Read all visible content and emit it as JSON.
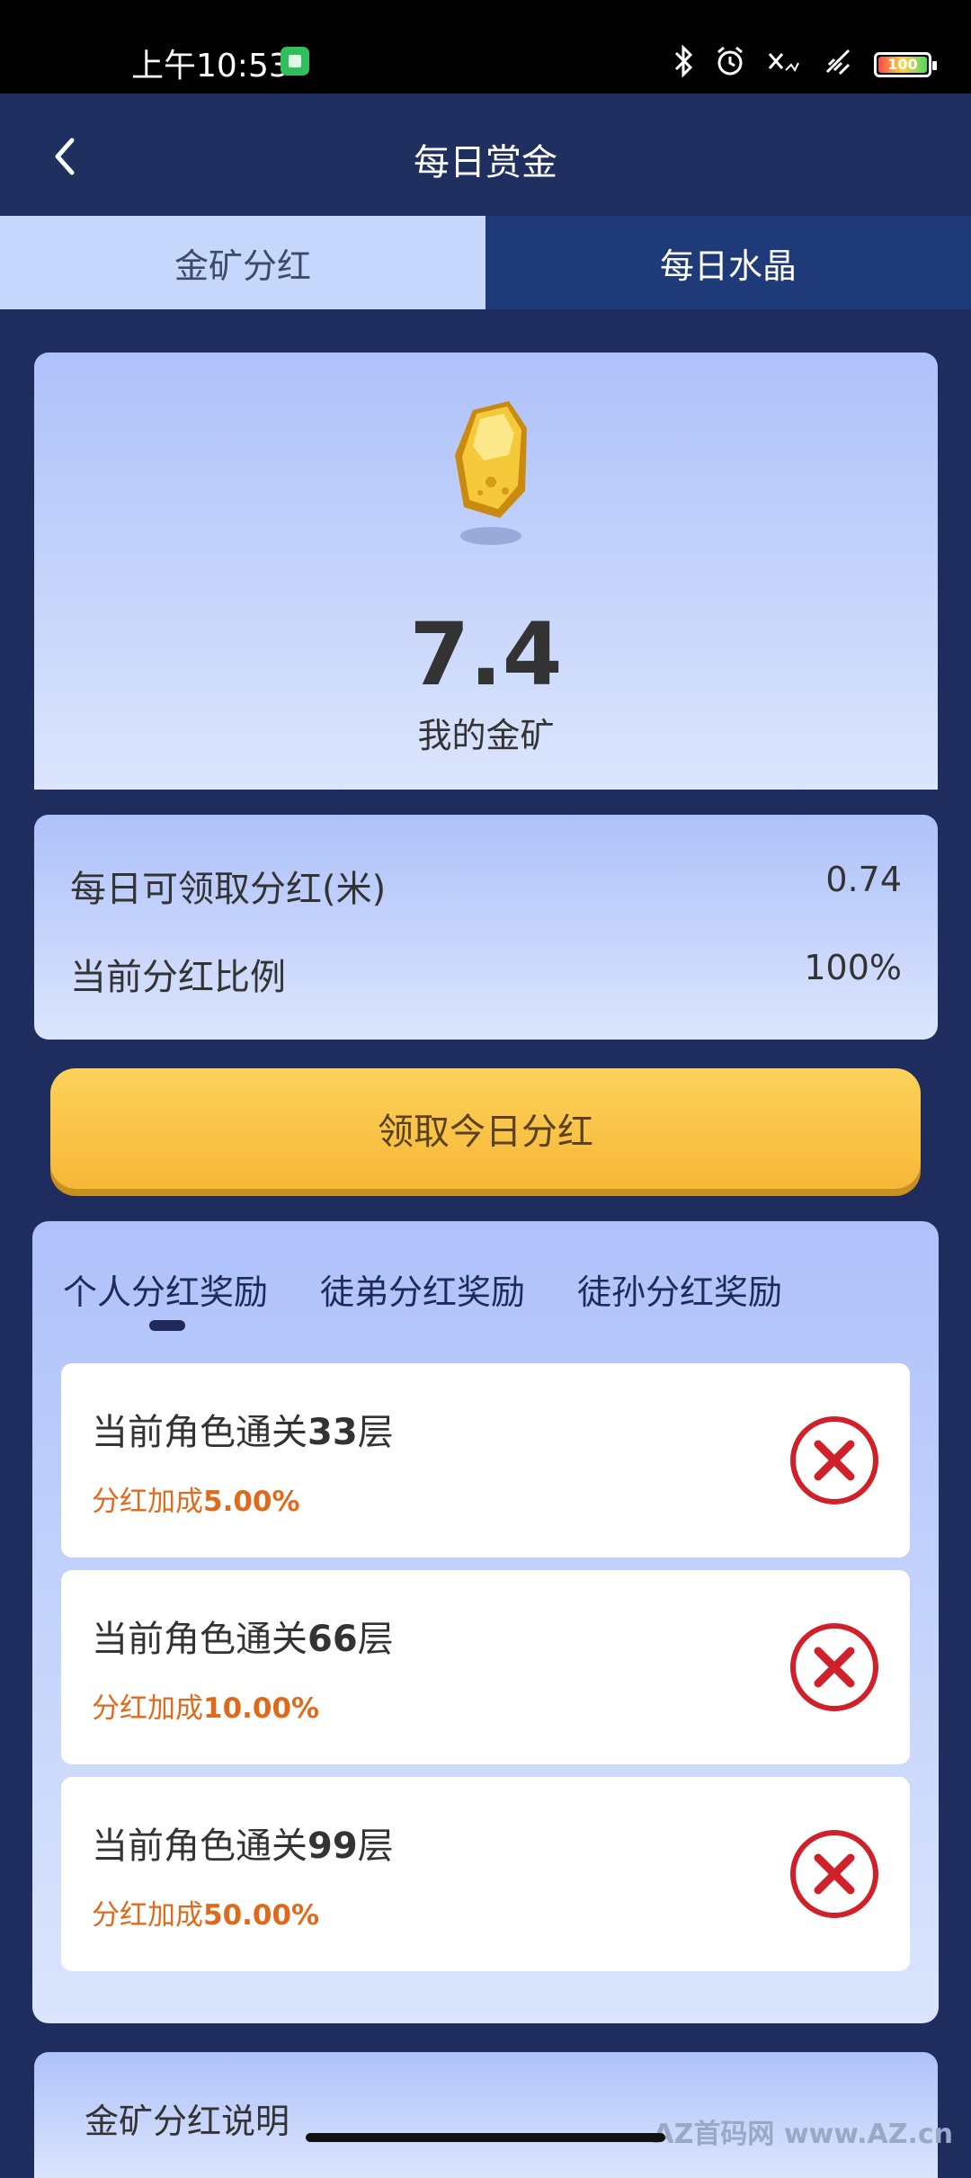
{
  "status_bar": {
    "time": "上午10:53",
    "icons": [
      "app-notification-icon",
      "bluetooth-icon",
      "alarm-icon",
      "no-signal-icon",
      "wifi-off-icon",
      "battery-icon"
    ],
    "battery_level": "100"
  },
  "header": {
    "title": "每日赏金"
  },
  "tabs": [
    {
      "label": "金矿分红",
      "active": true
    },
    {
      "label": "每日水晶",
      "active": false
    }
  ],
  "hero": {
    "value": "7.4",
    "label": "我的金矿"
  },
  "info": {
    "rows": [
      {
        "label": "每日可领取分红(米)",
        "value": "0.74"
      },
      {
        "label": "当前分红比例",
        "value": "100%"
      }
    ]
  },
  "claim_button": {
    "label": "领取今日分红"
  },
  "rewards": {
    "tabs": [
      {
        "label": "个人分红奖励",
        "active": true
      },
      {
        "label": "徒弟分红奖励",
        "active": false
      },
      {
        "label": "徒孙分红奖励",
        "active": false
      }
    ],
    "items": [
      {
        "title_prefix": "当前角色通关",
        "level": "33",
        "title_suffix": "层",
        "bonus_label": "分红加成",
        "bonus_value": "5.00%",
        "completed": false
      },
      {
        "title_prefix": "当前角色通关",
        "level": "66",
        "title_suffix": "层",
        "bonus_label": "分红加成",
        "bonus_value": "10.00%",
        "completed": false
      },
      {
        "title_prefix": "当前角色通关",
        "level": "99",
        "title_suffix": "层",
        "bonus_label": "分红加成",
        "bonus_value": "50.00%",
        "completed": false
      }
    ]
  },
  "explain": {
    "title": "金矿分红说明"
  },
  "watermark": "AZ首码网 www.AZ.cn",
  "colors": {
    "background": "#1e2d5e",
    "header": "#1f3060",
    "tab_active": "#c7d6fb",
    "tab_inactive": "#1f3a78",
    "card_top": "#aec1fa",
    "card_bottom": "#dbe5fc",
    "claim_button": "#f7b737",
    "bonus_text": "#e06a1b",
    "status_not_done": "#d0202a"
  }
}
